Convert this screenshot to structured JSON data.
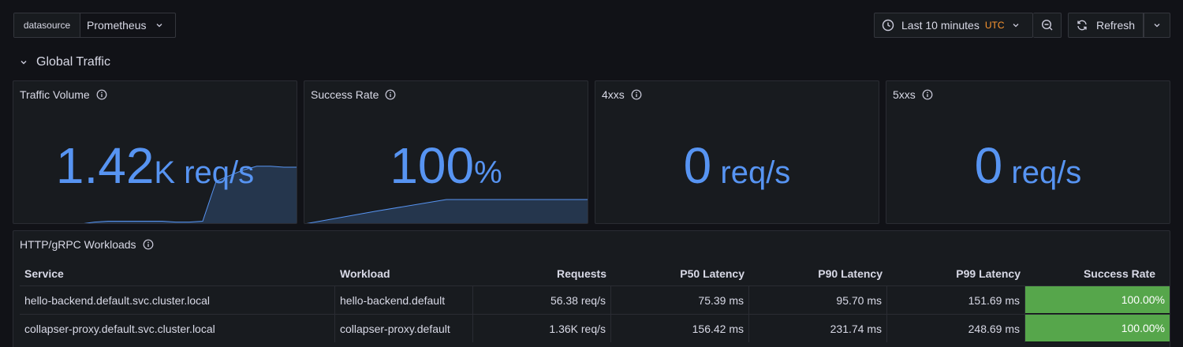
{
  "controls": {
    "datasource_label": "datasource",
    "datasource_value": "Prometheus",
    "time_range": "Last 10 minutes",
    "timezone": "UTC",
    "refresh_label": "Refresh"
  },
  "row": {
    "title": "Global Traffic"
  },
  "stats": [
    {
      "title": "Traffic Volume",
      "value": "1.42",
      "suffix": "K",
      "unit": " req/s",
      "color": "#5794f2"
    },
    {
      "title": "Success Rate",
      "value": "100",
      "suffix": "",
      "unit": "%",
      "color": "#5794f2"
    },
    {
      "title": "4xxs",
      "value": "0",
      "suffix": "",
      "unit": " req/s",
      "color": "#5794f2"
    },
    {
      "title": "5xxs",
      "value": "0",
      "suffix": "",
      "unit": " req/s",
      "color": "#5794f2"
    }
  ],
  "sparklines": {
    "traffic_volume": [
      0,
      0,
      0,
      0,
      0,
      0,
      0.02,
      0.03,
      0.03,
      0.03,
      0.03,
      0.03,
      0.02,
      0.02,
      0.03,
      0.46,
      0.52,
      0.58,
      0.62,
      0.62,
      0.61,
      0.61
    ],
    "success_rate": [
      0,
      0.52,
      1,
      1,
      1
    ]
  },
  "workloads": {
    "title": "HTTP/gRPC Workloads",
    "columns": [
      "Service",
      "Workload",
      "Requests",
      "P50 Latency",
      "P90 Latency",
      "P99 Latency",
      "Success Rate"
    ],
    "rows": [
      [
        "hello-backend.default.svc.cluster.local",
        "hello-backend.default",
        "56.38 req/s",
        "75.39 ms",
        "95.70 ms",
        "151.69 ms",
        "100.00%"
      ],
      [
        "collapser-proxy.default.svc.cluster.local",
        "collapser-proxy.default",
        "1.36K req/s",
        "156.42 ms",
        "231.74 ms",
        "248.69 ms",
        "100.00%"
      ]
    ],
    "success_color": "#56a64b"
  }
}
